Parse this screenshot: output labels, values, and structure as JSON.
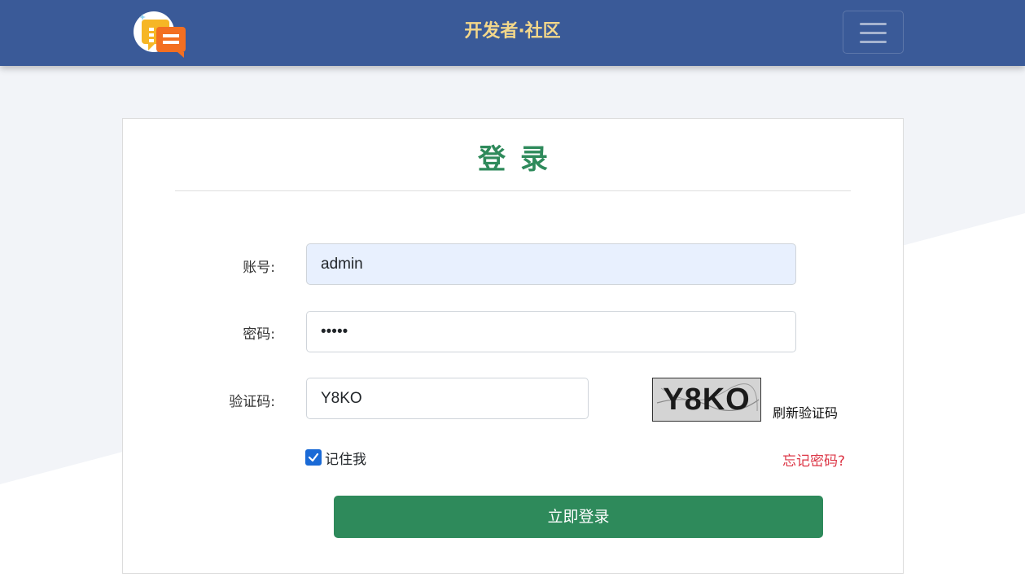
{
  "header": {
    "brand": "开发者·社区",
    "logo_icon": "chat-bubbles-logo",
    "menu_icon": "hamburger-menu-icon"
  },
  "login": {
    "title": "登录",
    "account_label": "账号:",
    "account_value": "admin",
    "password_label": "密码:",
    "password_value": "•••••",
    "captcha_label": "验证码:",
    "captcha_value": "Y8KO",
    "captcha_image_text": "Y8KO",
    "refresh_captcha": "刷新验证码",
    "remember_me": "记住我",
    "remember_checked": true,
    "forgot_password": "忘记密码?",
    "submit": "立即登录"
  },
  "colors": {
    "navbar": "#3a5a98",
    "brand_text": "#f3d78a",
    "title": "#2e8a5b",
    "submit": "#2e8a5b",
    "forgot": "#dc3545"
  }
}
